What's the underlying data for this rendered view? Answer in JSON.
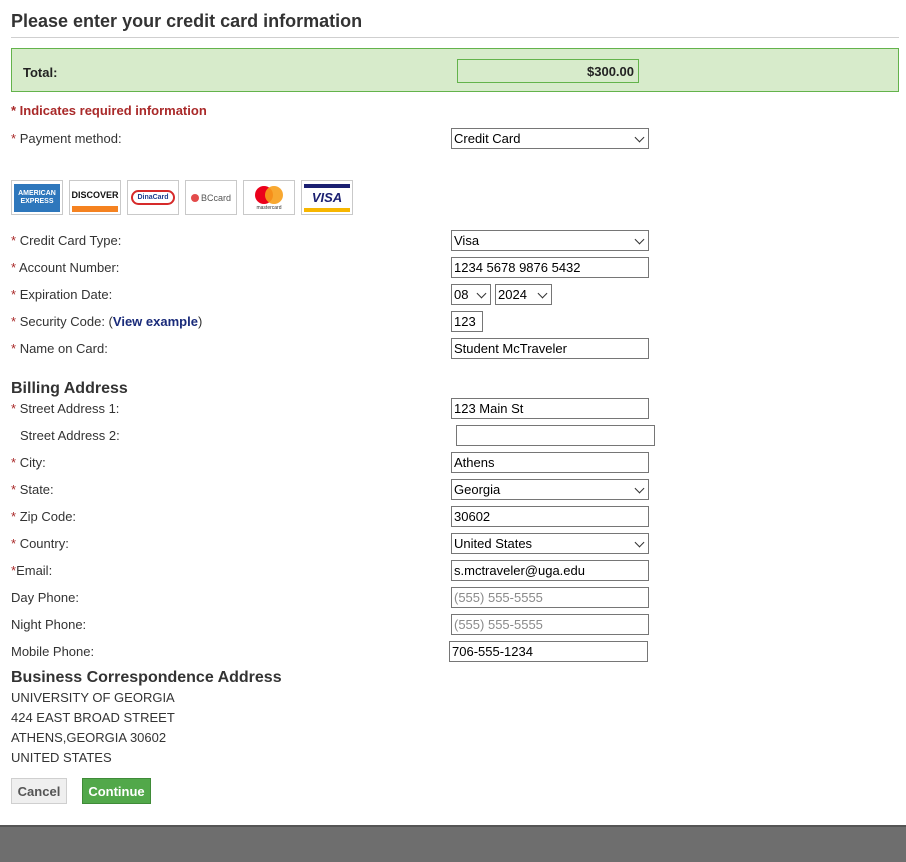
{
  "page": {
    "title": "Please enter your credit card information"
  },
  "total": {
    "label": "Total:",
    "value": "$300.00"
  },
  "required_note": "* Indicates required information",
  "required_marker": "*",
  "payment_method": {
    "label": "Payment method:",
    "value": "Credit Card"
  },
  "cards": [
    {
      "name": "american-express-card",
      "text1": "AMERICAN",
      "text2": "EXPRESS"
    },
    {
      "name": "discover-card",
      "text1": "DISCOVER"
    },
    {
      "name": "dinacard-card",
      "text1": "DinaCard"
    },
    {
      "name": "bccard-card",
      "text1": "BCcard"
    },
    {
      "name": "mastercard-card",
      "text1": "mastercard"
    },
    {
      "name": "visa-card",
      "text1": "VISA"
    }
  ],
  "card_form": {
    "card_type": {
      "label": "Credit Card Type:",
      "value": "Visa"
    },
    "account_number": {
      "label": "Account Number:",
      "value": "1234 5678 9876 5432"
    },
    "expiration": {
      "label": "Expiration Date:",
      "month": "08",
      "year": "2024"
    },
    "security_code": {
      "label_prefix": "Security Code: (",
      "link": "View example",
      "label_suffix": ")",
      "value": "123"
    },
    "name_on_card": {
      "label": "Name on Card:",
      "value": "Student McTraveler"
    }
  },
  "billing": {
    "heading": "Billing Address",
    "street1": {
      "label": "Street Address 1:",
      "value": "123 Main St"
    },
    "street2": {
      "label": "Street Address 2:",
      "value": ""
    },
    "city": {
      "label": "City:",
      "value": "Athens"
    },
    "state": {
      "label": "State:",
      "value": "Georgia"
    },
    "zip": {
      "label": "Zip Code:",
      "value": "30602"
    },
    "country": {
      "label": "Country:",
      "value": "United States"
    },
    "email": {
      "label": "Email:",
      "value": "s.mctraveler@uga.edu"
    },
    "day_phone": {
      "label": "Day Phone:",
      "placeholder": "(555) 555-5555"
    },
    "night_phone": {
      "label": "Night Phone:",
      "placeholder": "(555) 555-5555"
    },
    "mobile_phone": {
      "label": "Mobile Phone:",
      "value": "706-555-1234"
    }
  },
  "business": {
    "heading": "Business Correspondence Address",
    "lines": [
      "UNIVERSITY OF GEORGIA",
      "424 EAST BROAD STREET",
      "ATHENS,GEORGIA 30602",
      "UNITED STATES"
    ]
  },
  "buttons": {
    "cancel": "Cancel",
    "continue": "Continue"
  },
  "colors": {
    "accent_green": "#52a84a",
    "total_bg": "#d7ebcb",
    "required_red": "#a92929",
    "link_blue": "#1a2b7a"
  }
}
